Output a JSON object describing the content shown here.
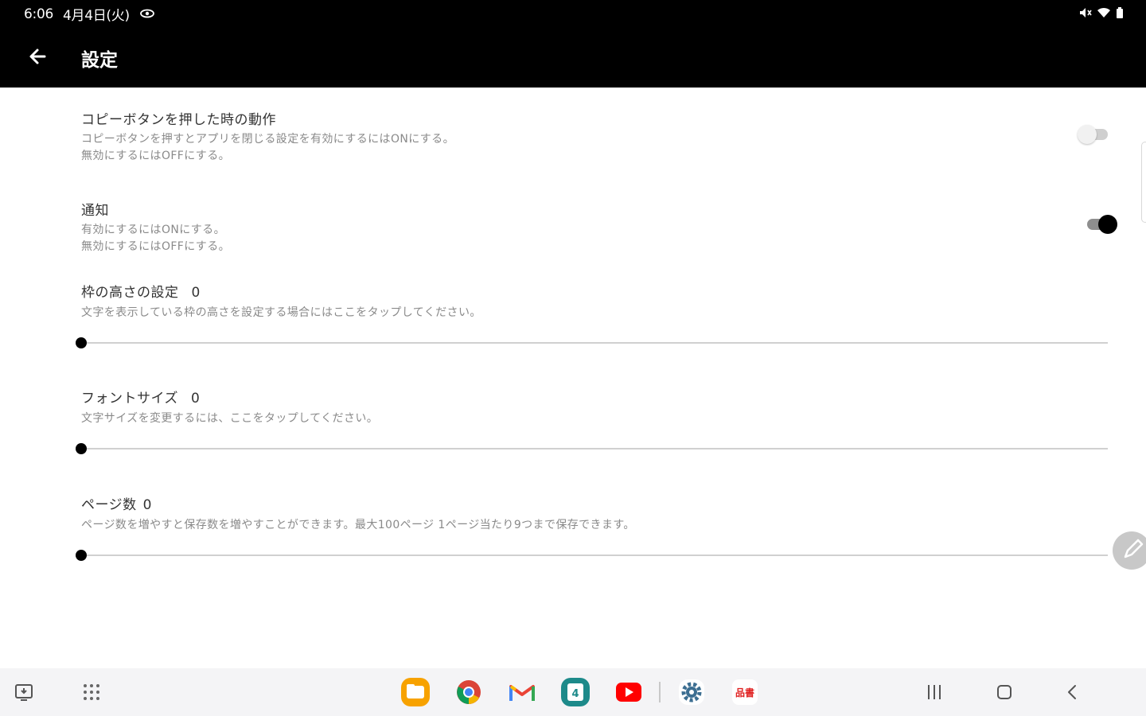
{
  "status_bar": {
    "time": "6:06",
    "date": "4月4日(火)"
  },
  "app_bar": {
    "title": "設定"
  },
  "preferences": [
    {
      "title": "コピーボタンを押した時の動作",
      "summary_line1": "コピーボタンを押すとアプリを閉じる設定を有効にするにはONにする。",
      "summary_line2": "無効にするにはOFFにする。",
      "switch_on": false
    },
    {
      "title": "通知",
      "summary_line1": "有効にするにはONにする。",
      "summary_line2": "無効にするにはOFFにする。",
      "switch_on": true
    }
  ],
  "sliders": [
    {
      "title": "枠の高さの設定",
      "value": "0",
      "summary": "文字を表示している枠の高さを設定する場合にはここをタップしてください。",
      "level": 0
    },
    {
      "title": "フォントサイズ",
      "value": "0",
      "summary": "文字サイズを変更するには、ここをタップしてください。",
      "level": 0
    },
    {
      "title": "ページ数",
      "value": "0",
      "summary": "ページ数を増やすと保存数を増やすことができます。最大100ページ 1ページ当たり9つまで保存できます。",
      "level": 0
    }
  ],
  "taskbar": {
    "apps": [
      "files-app-icon",
      "chrome-icon",
      "gmail-icon",
      "calendar-icon",
      "youtube-icon",
      "settings-icon",
      "app-icon"
    ],
    "calendar_day": "4",
    "app_badge_text": "品書"
  },
  "colors": {
    "app_bar": "#000000",
    "switch_on_thumb": "#000000",
    "switch_off_thumb": "#f1f1f1",
    "youtube": "#ff0000",
    "files": "#f7a200"
  }
}
